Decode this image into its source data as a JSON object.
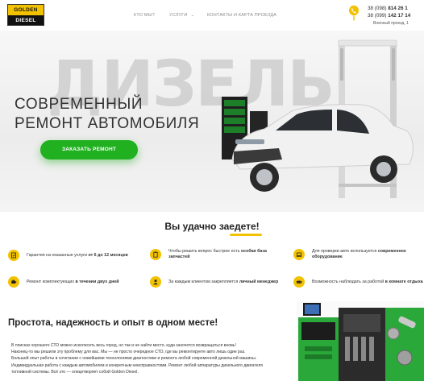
{
  "header": {
    "logo_line1": "GOLDEN",
    "logo_line2": "DIESEL",
    "nav": [
      "КТО МЫ?",
      "УСЛУГИ",
      "КОНТАКТЫ И КАРТА ПРОЕЗДА"
    ],
    "phone1_prefix": "38 (098)",
    "phone1_number": "814 26 1",
    "phone2_prefix": "38 (099)",
    "phone2_number": "142 17 14",
    "address": "Военный проезд, 1"
  },
  "hero": {
    "bigword": "ДИЗЕЛЬ",
    "title_line1": "СОВРЕМЕННЫЙ",
    "title_line2": "РЕМОНТ АВТОМОБИЛЯ",
    "cta": "ЗАКАЗАТЬ РЕМОНТ"
  },
  "features": {
    "title": "Вы удачно заедете!",
    "items": [
      {
        "pre": "Гарантия на оказанные услуги ",
        "bold": "от 6 до 12 месяцев",
        "post": "",
        "icon": "document-check-icon"
      },
      {
        "pre": "Чтобы решить вопрос быстрее есть ",
        "bold": "особая база запчастей",
        "post": "",
        "icon": "clipboard-icon"
      },
      {
        "pre": "Для проверки авто используется ",
        "bold": "современное оборудование",
        "post": "",
        "icon": "laptop-icon"
      },
      {
        "pre": "Ремонт комплектующих ",
        "bold": "в течении двух дней",
        "post": "",
        "icon": "engine-icon"
      },
      {
        "pre": "За каждым клиентом закрепляется ",
        "bold": "личный менеджер",
        "post": "",
        "icon": "manager-icon"
      },
      {
        "pre": "Возможность наблюдать за работой ",
        "bold": "в комнате отдыха",
        "post": "",
        "icon": "gamepad-icon"
      }
    ]
  },
  "about": {
    "title": "Простота, надежность и опыт в одном месте!",
    "lines": [
      "В поисках хорошего СТО можно исколесить весь город, но так и не найти место, куда захочется возвращаться вновь!",
      "Наконец-то мы решили эту проблему для вас. Мы — не просто очередное СТО, где вы ремонтируете авто лишь один раз.",
      "Большой опыт работы в сочетании с новейшими технологиями диагностики и ремонта любой современной дизельной машины.",
      "Индивидуальная работа с каждым автомобилем и конкретным неисправностями. Ремонт любой аппаратуры дизельного двигателя",
      "топливной системы. Всё это — олицетворяет собой Golden Diesel."
    ]
  },
  "colors": {
    "accent": "#f2c200",
    "cta": "#20b020"
  }
}
